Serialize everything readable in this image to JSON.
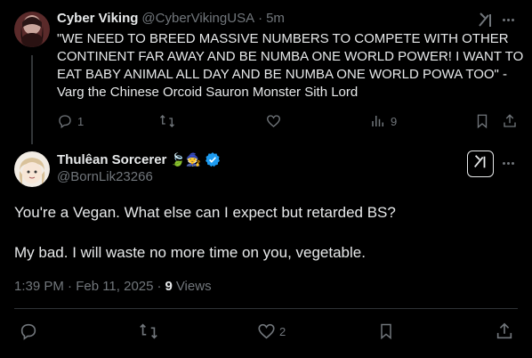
{
  "reply_tweet": {
    "display_name": "Cyber Viking",
    "handle": "@CyberVikingUSA",
    "separator": "·",
    "time": "5m",
    "text_lines": [
      "\"WE NEED TO BREED MASSIVE NUMBERS TO COMPETE WITH OTHER",
      "CONTINENT FAR AWAY AND BE NUMBA ONE WORLD POWER! I WANT TO",
      "EAT BABY ANIMAL ALL DAY AND BE NUMBA ONE WORLD POWA TOO\" -",
      "Varg the Chinese Orcoid Sauron Monster Sith Lord"
    ],
    "replies": "1",
    "views": "9"
  },
  "main_tweet": {
    "display_name": "Thulêan Sorcerer",
    "emoji": "🍃🧙",
    "handle": "@BornLik23266",
    "text_line_1": "You're a Vegan. What else can I expect but retarded BS?",
    "text_line_2": "My bad. I will waste no more time on you, vegetable.",
    "timestamp": "1:39 PM · Feb 11, 2025",
    "meta_separator": "·",
    "view_count": "9",
    "views_label": "Views",
    "likes": "2"
  },
  "icons": {
    "reply": "reply-icon",
    "retweet": "retweet-icon",
    "like": "heart-icon",
    "views": "analytics-icon",
    "bookmark": "bookmark-icon",
    "share": "share-icon",
    "grok": "grok-icon",
    "more": "more-dots-icon",
    "verified": "verified-badge-icon"
  },
  "colors": {
    "background": "#000000",
    "text": "#e7e9ea",
    "muted": "#71767b",
    "verified": "#1d9bf0"
  }
}
